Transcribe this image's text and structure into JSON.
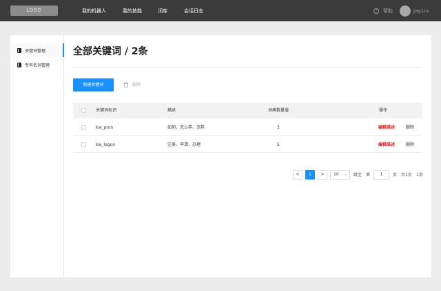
{
  "header": {
    "logo": "LOGO",
    "nav": [
      "我的机器人",
      "我的技能",
      "词库",
      "会话日志"
    ],
    "help_icon": "?",
    "help": "帮助",
    "username": "Jay.Liu"
  },
  "sidebar": {
    "items": [
      {
        "label": "关键词管理",
        "icon": "book-icon",
        "active": true
      },
      {
        "label": "专有名词管理",
        "icon": "book-icon",
        "active": false
      }
    ]
  },
  "main": {
    "title": "全部关键词 / 2条",
    "new_button": "新建关键词",
    "delete_button": "删除",
    "columns": [
      "关键词标识",
      "描述",
      "词典数量值",
      "操作"
    ],
    "rows": [
      {
        "id": "kw_pron",
        "desc": "如何、怎么样、怎样",
        "count": "3",
        "edit": "编辑描述",
        "delete": "删除"
      },
      {
        "id": "kw_logon",
        "desc": "注册、申请、办理",
        "count": "5",
        "edit": "编辑描述",
        "delete": "删除"
      }
    ],
    "accent_color": "#1890ff",
    "edit_color": "#e02020"
  },
  "pagination": {
    "prev": "<",
    "current": "1",
    "next": ">",
    "page_size": "10",
    "goto_label": "跳至",
    "page_prefix": "第",
    "goto_value": "1",
    "page_suffix": "页",
    "total_pages": "共1页",
    "total_items": "1条"
  }
}
